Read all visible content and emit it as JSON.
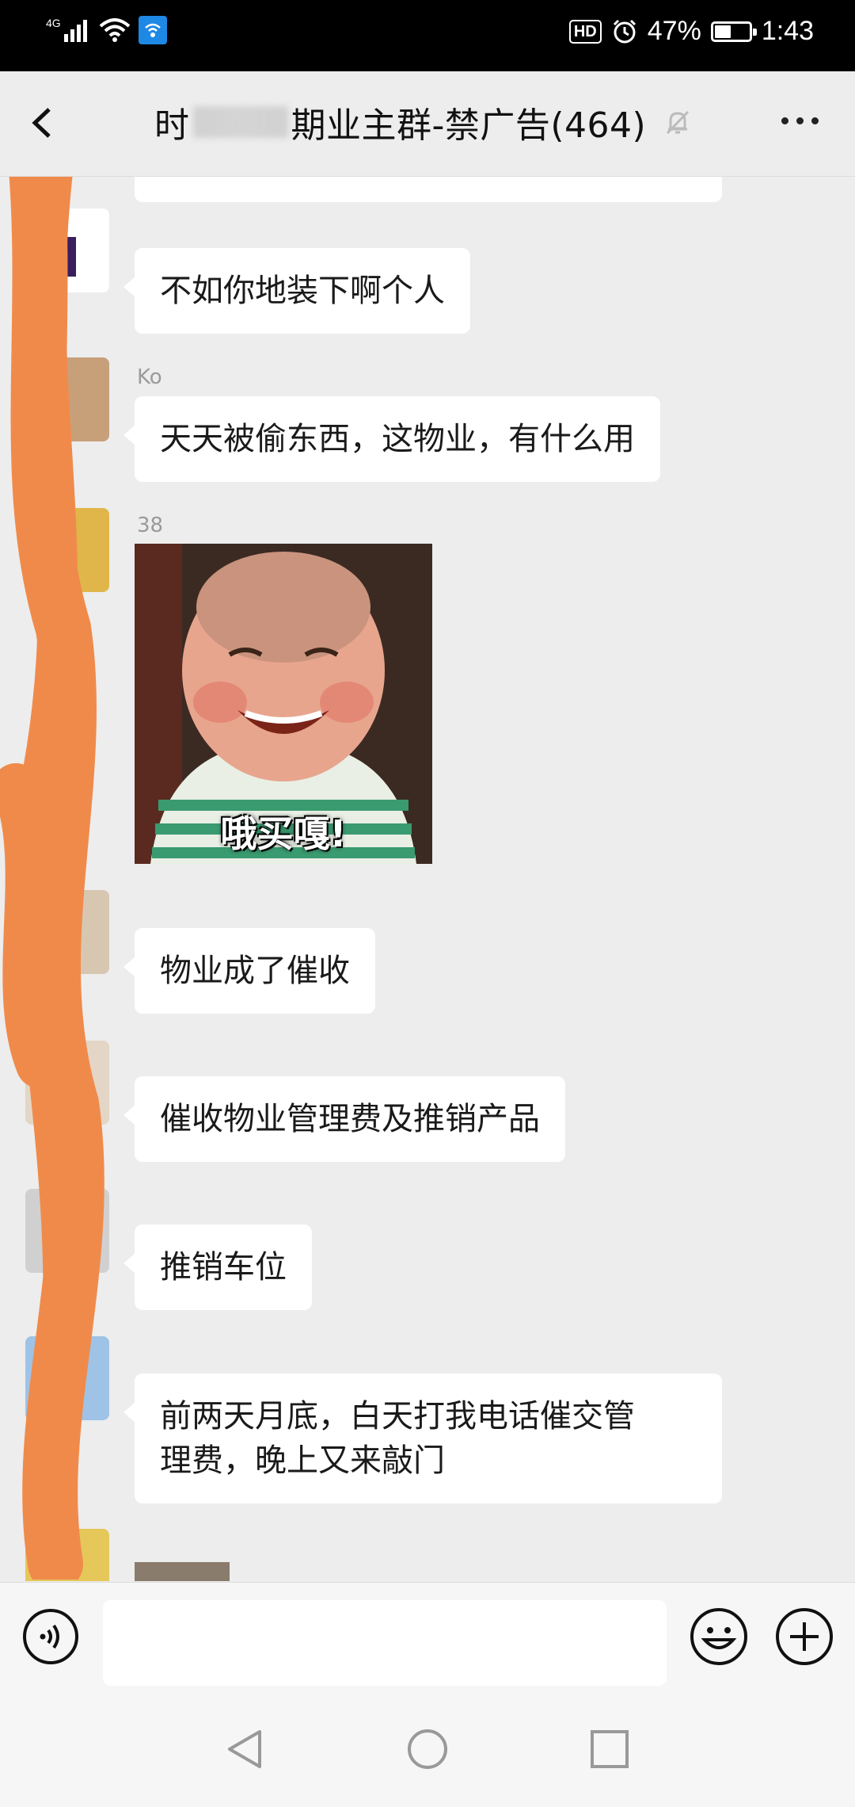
{
  "status_bar": {
    "network_label": "4G",
    "hd_label": "HD",
    "battery_percent": "47%",
    "battery_level": 0.47,
    "time": "1:43",
    "icons": [
      "signal-icon",
      "wifi-icon",
      "wifi-calling-icon",
      "hd-icon",
      "alarm-icon",
      "battery-icon"
    ]
  },
  "header": {
    "title_prefix": "时",
    "title_suffix": "期业主群-禁广告(464)",
    "icons": [
      "back-icon",
      "mute-icon",
      "more-icon"
    ]
  },
  "messages": [
    {
      "sender": "",
      "text": "不如你地装下啊个人"
    },
    {
      "sender": "Ko",
      "text": "天天被偷东西，这物业，有什么用"
    },
    {
      "sender": "38",
      "sticker_caption": "哦买嘎!"
    },
    {
      "sender": "",
      "text": "物业成了催收"
    },
    {
      "sender": "",
      "text": "催收物业管理费及推销产品"
    },
    {
      "sender": "",
      "text": "推销车位"
    },
    {
      "sender": "",
      "text_line1": "前两天月底，白天打我电话催交管",
      "text_line2": "理费，晚上又来敲门"
    }
  ],
  "input_bar": {
    "placeholder": "",
    "icons": [
      "voice-icon",
      "emoji-icon",
      "plus-icon"
    ]
  },
  "nav_bar": {
    "icons": [
      "nav-back-icon",
      "nav-home-icon",
      "nav-recent-icon"
    ]
  },
  "colors": {
    "background": "#ededed",
    "bubble": "#ffffff",
    "status_bar": "#000000",
    "redaction": "#f08a4b"
  }
}
